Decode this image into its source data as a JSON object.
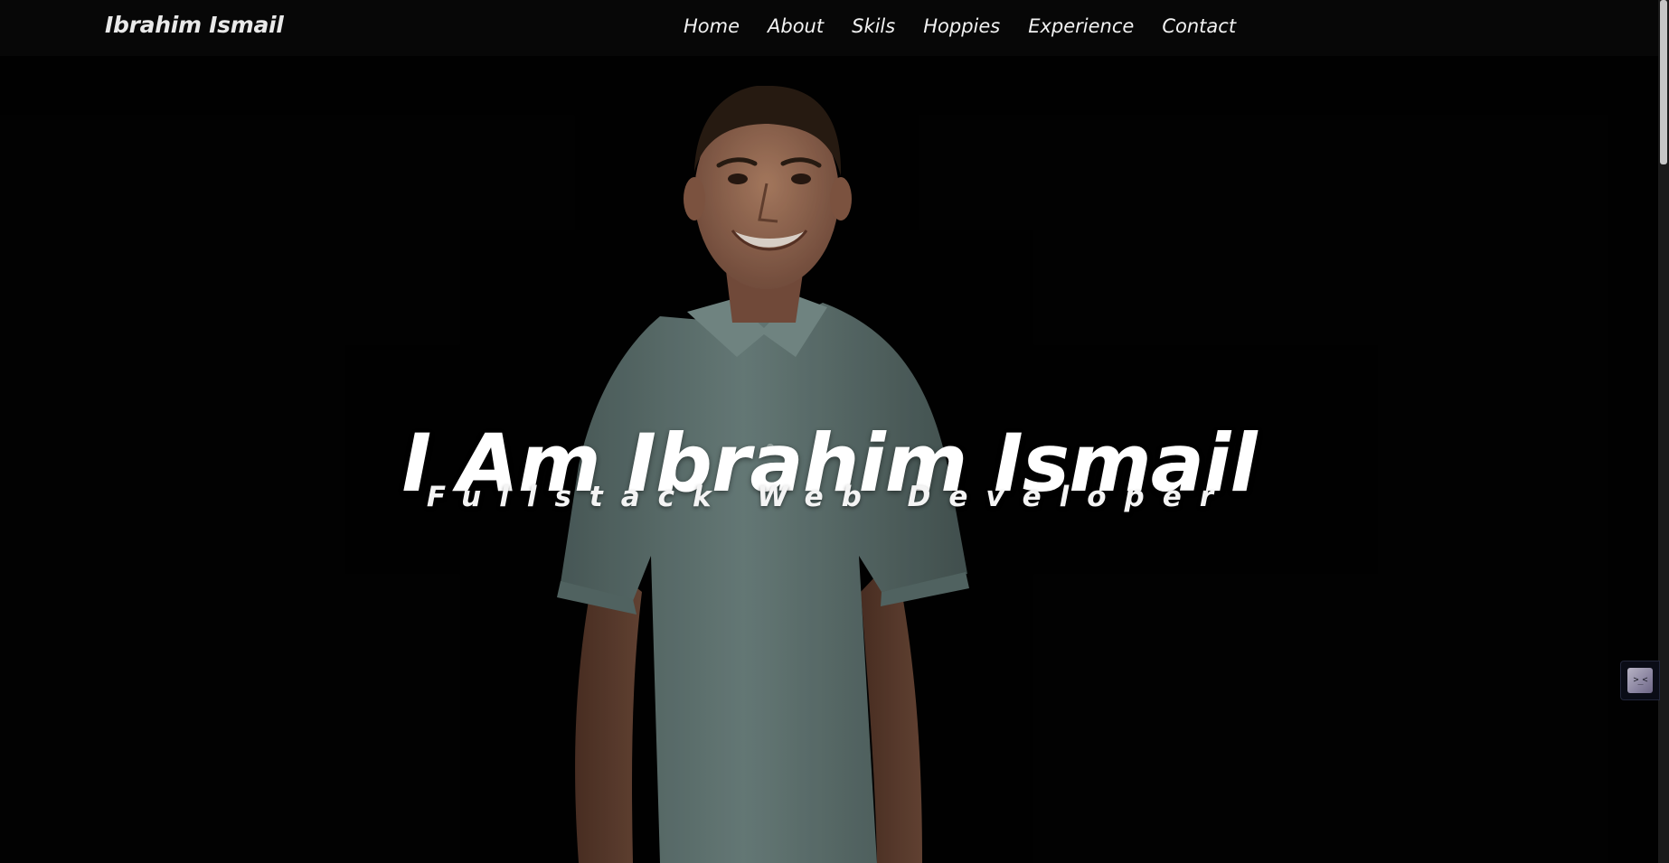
{
  "brand": {
    "name": "Ibrahim Ismail"
  },
  "nav": {
    "items": [
      {
        "label": "Home"
      },
      {
        "label": "About"
      },
      {
        "label": "Skils"
      },
      {
        "label": "Hoppies"
      },
      {
        "label": "Experience"
      },
      {
        "label": "Contact"
      }
    ]
  },
  "hero": {
    "title": "I Am Ibrahim Ismail",
    "subtitle": "Fullstack Web Developer",
    "portrait": {
      "shirt_color": "#6f8582",
      "skin_color": "#b07d60",
      "hair_color": "#2b1d14"
    }
  },
  "floating_widget": {
    "icon": "chat-bot-icon",
    "glyph": ">_<"
  },
  "colors": {
    "background": "#020202",
    "navbar": "#070707",
    "text": "#ffffff"
  }
}
